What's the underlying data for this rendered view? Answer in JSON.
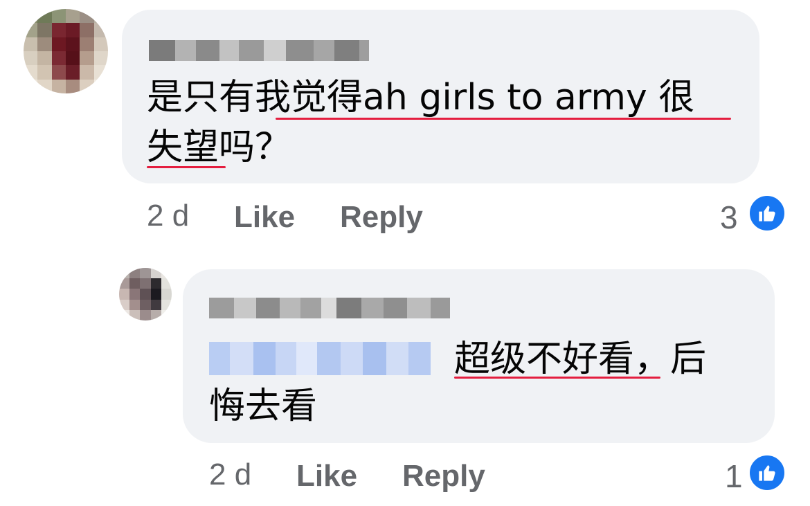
{
  "comments": [
    {
      "text_line1": "是只有我觉得ah girls to army 很",
      "text_line2": "失望吗？",
      "time": "2 d",
      "like_label": "Like",
      "reply_label": "Reply",
      "reaction_count": "3"
    },
    {
      "text_line1": "超级不好看，后",
      "text_line2": "悔去看",
      "time": "2 d",
      "like_label": "Like",
      "reply_label": "Reply",
      "reaction_count": "1"
    }
  ],
  "colors": {
    "bubble": "#f0f2f5",
    "meta_text": "#65676b",
    "spellcheck_underline": "#e41e3f",
    "like_blue": "#1877f2",
    "mention_blue": "#c3d4f5"
  },
  "icons": {
    "reaction": "thumbs-up-icon"
  }
}
